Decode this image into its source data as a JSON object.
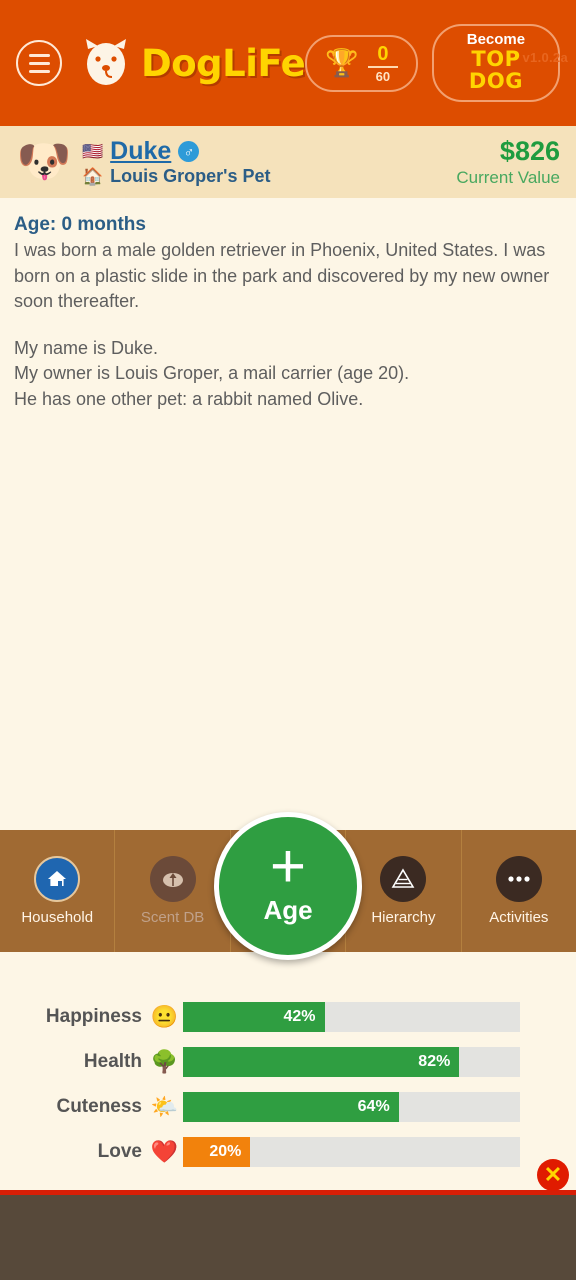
{
  "header": {
    "menu_icon": "hamburger-menu-icon",
    "logo_icon": "dog-face-logo-icon",
    "logo_text": "DogLiFe",
    "version": "v1.0.2a",
    "trophy_icon": "trophy-icon",
    "trophy_current": "0",
    "trophy_total": "60",
    "topdog_small": "Become",
    "topdog_large": "TOP DOG",
    "bg_color": "#dd4d00",
    "accent_yellow": "#ffd400"
  },
  "character": {
    "avatar_icon": "dog-avatar-icon",
    "avatar_glyph": "🐶",
    "flag_icon": "us-flag-icon",
    "flag_glyph": "🇺🇸",
    "name": "Duke",
    "gender_icon": "male-gender-icon",
    "gender_glyph": "♂",
    "home_icon": "house-icon",
    "home_glyph": "🏠",
    "owner": "Louis Groper's Pet",
    "money": "$826",
    "money_label": "Current Value",
    "bg_color": "#f5e2bb",
    "money_color": "#1f9c3f"
  },
  "story": {
    "age_heading": "Age: 0 months",
    "paragraph1": "I was born a male golden retriever in Phoenix, United States. I was born on a plastic slide in the park and discovered by my new owner soon thereafter.",
    "line1": "My name is Duke.",
    "line2": "My owner is Louis Groper, a mail carrier (age 20).",
    "line3": "He has one other pet: a rabbit named Olive."
  },
  "nav": {
    "bg_color": "#a06a33",
    "items": [
      {
        "label": "Household",
        "icon": "house-icon",
        "state": "active"
      },
      {
        "label": "Scent DB",
        "icon": "dog-nose-icon",
        "state": "disabled"
      },
      {
        "label": "Hierarchy",
        "icon": "pyramid-icon",
        "state": "normal"
      },
      {
        "label": "Activities",
        "icon": "ellipsis-icon",
        "state": "normal"
      }
    ],
    "age_button": {
      "plus_icon": "plus-icon",
      "label": "Age",
      "color": "#2f9e41"
    }
  },
  "chart_data": {
    "type": "bar",
    "title": "",
    "xlabel": "",
    "ylabel": "",
    "xlim": [
      0,
      100
    ],
    "grid": false,
    "legend": "none",
    "orientation": "horizontal",
    "categories": [
      "Happiness",
      "Health",
      "Cuteness",
      "Love"
    ],
    "values": [
      42,
      82,
      64,
      20
    ],
    "labels": [
      "42%",
      "82%",
      "64%",
      "20%"
    ],
    "emojis": [
      "😐",
      "🌳",
      "🌤️",
      "❤️"
    ],
    "emoji_names": [
      "neutral-face-icon",
      "tree-icon",
      "sun-behind-cloud-icon",
      "red-heart-icon"
    ],
    "colors": [
      "#2f9e41",
      "#2f9e41",
      "#2f9e41",
      "#f2820c"
    ],
    "track_color": "#e3e3e0"
  },
  "footer": {
    "close_icon": "close-x-icon",
    "close_glyph": "✕",
    "rule_color": "#d81e06",
    "bg_color": "#57493a"
  }
}
